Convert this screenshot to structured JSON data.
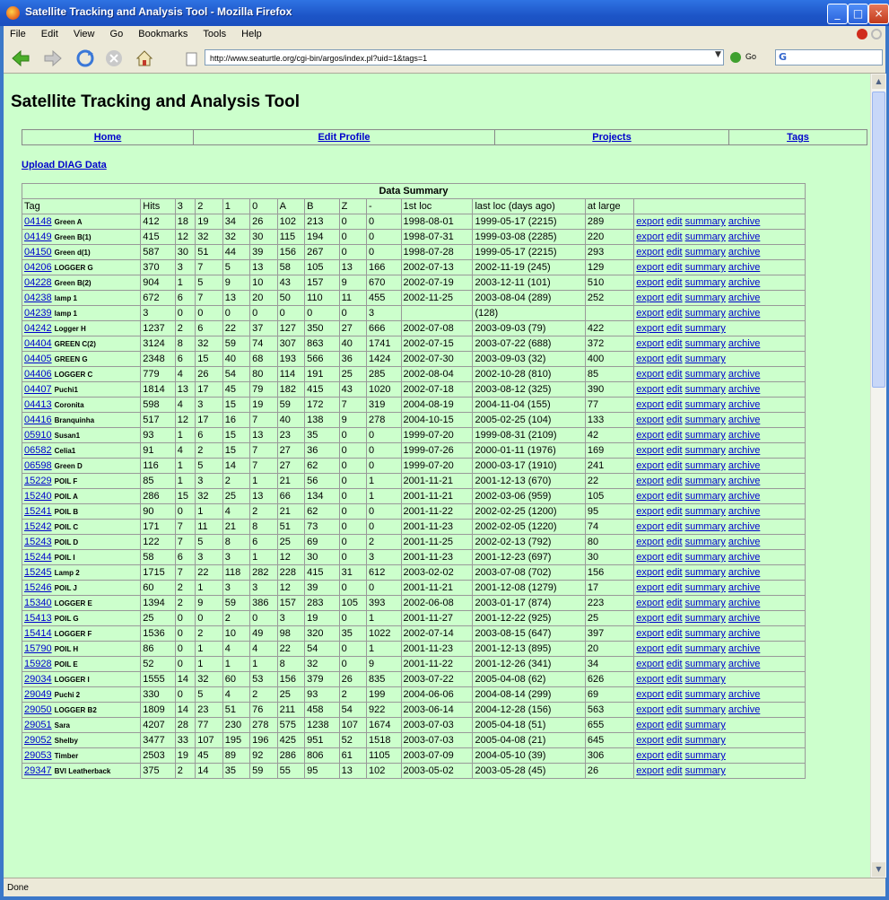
{
  "window": {
    "title": "Satellite Tracking and Analysis Tool - Mozilla Firefox"
  },
  "menu": [
    "File",
    "Edit",
    "View",
    "Go",
    "Bookmarks",
    "Tools",
    "Help"
  ],
  "url": "http://www.seaturtle.org/cgi-bin/argos/index.pl?uid=1&tags=1",
  "go_label": "Go",
  "page": {
    "title": "Satellite Tracking and Analysis Tool",
    "nav": [
      "Home",
      "Edit Profile",
      "Projects",
      "Tags"
    ],
    "upload": "Upload DIAG Data",
    "table_title": "Data Summary",
    "headers": [
      "Tag",
      "Hits",
      "3",
      "2",
      "1",
      "0",
      "A",
      "B",
      "Z",
      "-",
      "1st loc",
      "last loc (days ago)",
      "at large"
    ],
    "actions": {
      "export": "export",
      "edit": "edit",
      "summary": "summary",
      "archive": "archive"
    },
    "rows": [
      [
        "04148",
        "Green A",
        "412",
        "18",
        "19",
        "34",
        "26",
        "102",
        "213",
        "0",
        "0",
        "1998-08-01",
        "1999-05-17 (2215)",
        "289",
        "a"
      ],
      [
        "04149",
        "Green B(1)",
        "415",
        "12",
        "32",
        "32",
        "30",
        "115",
        "194",
        "0",
        "0",
        "1998-07-31",
        "1999-03-08 (2285)",
        "220",
        "a"
      ],
      [
        "04150",
        "Green d(1)",
        "587",
        "30",
        "51",
        "44",
        "39",
        "156",
        "267",
        "0",
        "0",
        "1998-07-28",
        "1999-05-17 (2215)",
        "293",
        "a"
      ],
      [
        "04206",
        "LOGGER G",
        "370",
        "3",
        "7",
        "5",
        "13",
        "58",
        "105",
        "13",
        "166",
        "2002-07-13",
        "2002-11-19 (245)",
        "129",
        "a"
      ],
      [
        "04228",
        "Green B(2)",
        "904",
        "1",
        "5",
        "9",
        "10",
        "43",
        "157",
        "9",
        "670",
        "2002-07-19",
        "2003-12-11 (101)",
        "510",
        "a"
      ],
      [
        "04238",
        "lamp 1",
        "672",
        "6",
        "7",
        "13",
        "20",
        "50",
        "110",
        "11",
        "455",
        "2002-11-25",
        "2003-08-04 (289)",
        "252",
        "a"
      ],
      [
        "04239",
        "lamp 1",
        "3",
        "0",
        "0",
        "0",
        "0",
        "0",
        "0",
        "0",
        "3",
        "",
        "(128)",
        "",
        "a"
      ],
      [
        "04242",
        "Logger H",
        "1237",
        "2",
        "6",
        "22",
        "37",
        "127",
        "350",
        "27",
        "666",
        "2002-07-08",
        "2003-09-03 (79)",
        "422",
        "s"
      ],
      [
        "04404",
        "GREEN C(2)",
        "3124",
        "8",
        "32",
        "59",
        "74",
        "307",
        "863",
        "40",
        "1741",
        "2002-07-15",
        "2003-07-22 (688)",
        "372",
        "a"
      ],
      [
        "04405",
        "GREEN G",
        "2348",
        "6",
        "15",
        "40",
        "68",
        "193",
        "566",
        "36",
        "1424",
        "2002-07-30",
        "2003-09-03 (32)",
        "400",
        "s"
      ],
      [
        "04406",
        "LOGGER C",
        "779",
        "4",
        "26",
        "54",
        "80",
        "114",
        "191",
        "25",
        "285",
        "2002-08-04",
        "2002-10-28 (810)",
        "85",
        "a"
      ],
      [
        "04407",
        "Puchi1",
        "1814",
        "13",
        "17",
        "45",
        "79",
        "182",
        "415",
        "43",
        "1020",
        "2002-07-18",
        "2003-08-12 (325)",
        "390",
        "a"
      ],
      [
        "04413",
        "Coronita",
        "598",
        "4",
        "3",
        "15",
        "19",
        "59",
        "172",
        "7",
        "319",
        "2004-08-19",
        "2004-11-04 (155)",
        "77",
        "a"
      ],
      [
        "04416",
        "Branquinha",
        "517",
        "12",
        "17",
        "16",
        "7",
        "40",
        "138",
        "9",
        "278",
        "2004-10-15",
        "2005-02-25 (104)",
        "133",
        "a"
      ],
      [
        "05910",
        "Susan1",
        "93",
        "1",
        "6",
        "15",
        "13",
        "23",
        "35",
        "0",
        "0",
        "1999-07-20",
        "1999-08-31 (2109)",
        "42",
        "a"
      ],
      [
        "06582",
        "Celia1",
        "91",
        "4",
        "2",
        "15",
        "7",
        "27",
        "36",
        "0",
        "0",
        "1999-07-26",
        "2000-01-11 (1976)",
        "169",
        "a"
      ],
      [
        "06598",
        "Green D",
        "116",
        "1",
        "5",
        "14",
        "7",
        "27",
        "62",
        "0",
        "0",
        "1999-07-20",
        "2000-03-17 (1910)",
        "241",
        "a"
      ],
      [
        "15229",
        "POIL F",
        "85",
        "1",
        "3",
        "2",
        "1",
        "21",
        "56",
        "0",
        "1",
        "2001-11-21",
        "2001-12-13 (670)",
        "22",
        "a"
      ],
      [
        "15240",
        "POIL A",
        "286",
        "15",
        "32",
        "25",
        "13",
        "66",
        "134",
        "0",
        "1",
        "2001-11-21",
        "2002-03-06 (959)",
        "105",
        "a"
      ],
      [
        "15241",
        "POIL B",
        "90",
        "0",
        "1",
        "4",
        "2",
        "21",
        "62",
        "0",
        "0",
        "2001-11-22",
        "2002-02-25 (1200)",
        "95",
        "a"
      ],
      [
        "15242",
        "POIL C",
        "171",
        "7",
        "11",
        "21",
        "8",
        "51",
        "73",
        "0",
        "0",
        "2001-11-23",
        "2002-02-05 (1220)",
        "74",
        "a"
      ],
      [
        "15243",
        "POIL D",
        "122",
        "7",
        "5",
        "8",
        "6",
        "25",
        "69",
        "0",
        "2",
        "2001-11-25",
        "2002-02-13 (792)",
        "80",
        "a"
      ],
      [
        "15244",
        "POIL I",
        "58",
        "6",
        "3",
        "3",
        "1",
        "12",
        "30",
        "0",
        "3",
        "2001-11-23",
        "2001-12-23 (697)",
        "30",
        "a"
      ],
      [
        "15245",
        "Lamp 2",
        "1715",
        "7",
        "22",
        "118",
        "282",
        "228",
        "415",
        "31",
        "612",
        "2003-02-02",
        "2003-07-08 (702)",
        "156",
        "a"
      ],
      [
        "15246",
        "POIL J",
        "60",
        "2",
        "1",
        "3",
        "3",
        "12",
        "39",
        "0",
        "0",
        "2001-11-21",
        "2001-12-08 (1279)",
        "17",
        "a"
      ],
      [
        "15340",
        "LOGGER E",
        "1394",
        "2",
        "9",
        "59",
        "386",
        "157",
        "283",
        "105",
        "393",
        "2002-06-08",
        "2003-01-17 (874)",
        "223",
        "a"
      ],
      [
        "15413",
        "POIL G",
        "25",
        "0",
        "0",
        "2",
        "0",
        "3",
        "19",
        "0",
        "1",
        "2001-11-27",
        "2001-12-22 (925)",
        "25",
        "a"
      ],
      [
        "15414",
        "LOGGER F",
        "1536",
        "0",
        "2",
        "10",
        "49",
        "98",
        "320",
        "35",
        "1022",
        "2002-07-14",
        "2003-08-15 (647)",
        "397",
        "a"
      ],
      [
        "15790",
        "POIL H",
        "86",
        "0",
        "1",
        "4",
        "4",
        "22",
        "54",
        "0",
        "1",
        "2001-11-23",
        "2001-12-13 (895)",
        "20",
        "a"
      ],
      [
        "15928",
        "POIL E",
        "52",
        "0",
        "1",
        "1",
        "1",
        "8",
        "32",
        "0",
        "9",
        "2001-11-22",
        "2001-12-26 (341)",
        "34",
        "a"
      ],
      [
        "29034",
        "LOGGER I",
        "1555",
        "14",
        "32",
        "60",
        "53",
        "156",
        "379",
        "26",
        "835",
        "2003-07-22",
        "2005-04-08 (62)",
        "626",
        "s"
      ],
      [
        "29049",
        "Puchi 2",
        "330",
        "0",
        "5",
        "4",
        "2",
        "25",
        "93",
        "2",
        "199",
        "2004-06-06",
        "2004-08-14 (299)",
        "69",
        "a"
      ],
      [
        "29050",
        "LOGGER B2",
        "1809",
        "14",
        "23",
        "51",
        "76",
        "211",
        "458",
        "54",
        "922",
        "2003-06-14",
        "2004-12-28 (156)",
        "563",
        "a"
      ],
      [
        "29051",
        "Sara",
        "4207",
        "28",
        "77",
        "230",
        "278",
        "575",
        "1238",
        "107",
        "1674",
        "2003-07-03",
        "2005-04-18 (51)",
        "655",
        "s"
      ],
      [
        "29052",
        "Shelby",
        "3477",
        "33",
        "107",
        "195",
        "196",
        "425",
        "951",
        "52",
        "1518",
        "2003-07-03",
        "2005-04-08 (21)",
        "645",
        "s"
      ],
      [
        "29053",
        "Timber",
        "2503",
        "19",
        "45",
        "89",
        "92",
        "286",
        "806",
        "61",
        "1105",
        "2003-07-09",
        "2004-05-10 (39)",
        "306",
        "s"
      ],
      [
        "29347",
        "BVI Leatherback",
        "375",
        "2",
        "14",
        "35",
        "59",
        "55",
        "95",
        "13",
        "102",
        "2003-05-02",
        "2003-05-28 (45)",
        "26",
        "s"
      ]
    ]
  },
  "status": "Done"
}
